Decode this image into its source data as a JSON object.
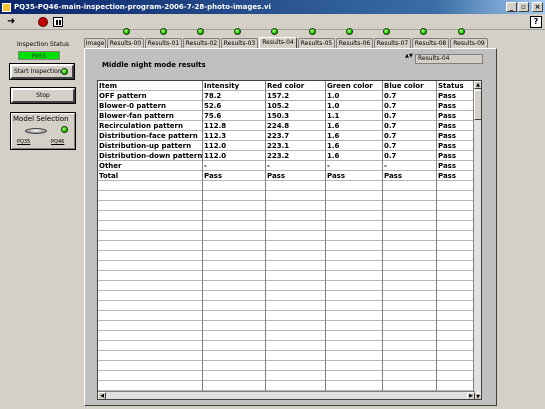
{
  "window": {
    "title": "PQ35-PQ46-main-inspection-program-2006-7-28-photo-images.vi",
    "minimize_icon": "_",
    "restore_icon": "▫",
    "close_icon": "×"
  },
  "toolbar": {
    "run_icon": "run-arrow-icon",
    "run_glyph": "➜",
    "abort_icon": "abort-stop-icon",
    "pause_icon": "pause-icon",
    "help_glyph": "?"
  },
  "left_panel": {
    "status_label": "Inspection Status",
    "status_value": "PASS",
    "start_label": "Start Inspection",
    "stop_label": "Stop",
    "model": {
      "title": "Model Selection",
      "option_a": "PQ35",
      "option_b": "PQ46"
    }
  },
  "colors": {
    "led_on": "#20c000",
    "pass_indicator": "#00e000",
    "title_bar": "#0a246a",
    "panel_bg": "#d4d0c8"
  },
  "tabs": [
    "Image",
    "Results-00",
    "Results-01",
    "Results-02",
    "Results-03",
    "Results-04",
    "Results-05",
    "Results-06",
    "Results-07",
    "Results-08",
    "Results-09"
  ],
  "active_tab": "Results-04",
  "main": {
    "section_title": "Middle night mode results",
    "ring_value": "Results-04",
    "ring_arrows": "▲▼",
    "scroll_up": "▲",
    "scroll_down": "▼",
    "scroll_left": "◀",
    "scroll_right": "▶"
  },
  "table": {
    "headers": [
      "Item",
      "Intensity",
      "Red color",
      "Green color",
      "Blue color",
      "Status"
    ],
    "rows": [
      [
        "OFF pattern",
        "78.2",
        "157.2",
        "1.0",
        "0.7",
        "Pass"
      ],
      [
        "Blower-0 pattern",
        "52.6",
        "105.2",
        "1.0",
        "0.7",
        "Pass"
      ],
      [
        "Blower-fan pattern",
        "75.6",
        "150.3",
        "1.1",
        "0.7",
        "Pass"
      ],
      [
        "Recirculation pattern",
        "112.8",
        "224.8",
        "1.6",
        "0.7",
        "Pass"
      ],
      [
        "Distribution-face pattern",
        "112.3",
        "223.7",
        "1.6",
        "0.7",
        "Pass"
      ],
      [
        "Distribution-up pattern",
        "112.0",
        "223.1",
        "1.6",
        "0.7",
        "Pass"
      ],
      [
        "Distribution-down pattern",
        "112.0",
        "223.2",
        "1.6",
        "0.7",
        "Pass"
      ],
      [
        "Other",
        "-",
        "-",
        "-",
        "-",
        "Pass"
      ],
      [
        "Total",
        "Pass",
        "Pass",
        "Pass",
        "Pass",
        "Pass"
      ]
    ]
  }
}
